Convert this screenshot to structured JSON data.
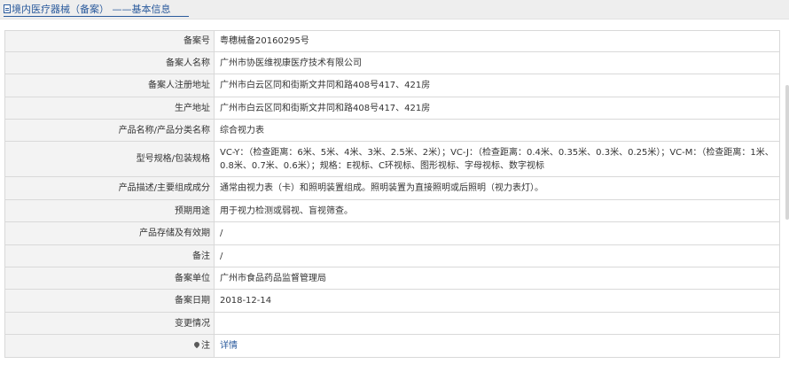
{
  "breadcrumb": {
    "text": "境内医疗器械（备案）  ——基本信息"
  },
  "rows": [
    {
      "label": "备案号",
      "value": "粤穗械备20160295号"
    },
    {
      "label": "备案人名称",
      "value": "广州市协医维视康医疗技术有限公司"
    },
    {
      "label": "备案人注册地址",
      "value": "广州市白云区同和街斯文井同和路408号417、421房"
    },
    {
      "label": "生产地址",
      "value": "广州市白云区同和街斯文井同和路408号417、421房"
    },
    {
      "label": "产品名称/产品分类名称",
      "value": "综合视力表"
    },
    {
      "label": "型号规格/包装规格",
      "value": "VC-Y：（检查距离：6米、5米、4米、3米、2.5米、2米）；VC-J：（检查距离：0.4米、0.35米、0.3米、0.25米）；VC-M：（检查距离：1米、0.8米、0.7米、0.6米）；规格：E视标、C环视标、图形视标、字母视标、数字视标"
    },
    {
      "label": "产品描述/主要组成成分",
      "value": "通常由视力表（卡）和照明装置组成。照明装置为直接照明或后照明（视力表灯）。"
    },
    {
      "label": "预期用途",
      "value": "用于视力检测或弱视、盲视筛查。"
    },
    {
      "label": "产品存储及有效期",
      "value": "/"
    },
    {
      "label": "备注",
      "value": "/"
    },
    {
      "label": "备案单位",
      "value": "广州市食品药品监督管理局"
    },
    {
      "label": "备案日期",
      "value": "2018-12-14"
    },
    {
      "label": "变更情况",
      "value": ""
    },
    {
      "label": "注",
      "value": "详情",
      "icon": "location-pin-icon"
    }
  ]
}
